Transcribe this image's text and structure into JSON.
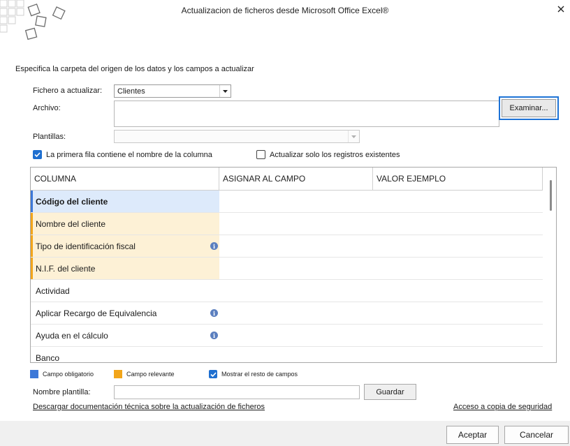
{
  "window": {
    "title": "Actualizacion de ficheros desde Microsoft Office Excel®",
    "close_icon": "close-icon"
  },
  "form": {
    "subtitle": "Especifica la carpeta del origen de los datos y los campos a actualizar",
    "fichero_label": "Fichero a actualizar:",
    "fichero_value": "Clientes",
    "archivo_label": "Archivo:",
    "archivo_value": "",
    "examinar_label": "Examinar...",
    "plantillas_label": "Plantillas:",
    "plantillas_value": "",
    "primera_fila_label": "La primera fila contiene el nombre de la columna",
    "primera_fila_checked": true,
    "actualizar_label": "Actualizar solo los registros existentes",
    "actualizar_checked": false
  },
  "grid": {
    "columns": [
      "COLUMNA",
      "ASIGNAR AL CAMPO",
      "VALOR EJEMPLO"
    ],
    "rows": [
      {
        "name": "Código del cliente",
        "state": "selected",
        "info": false
      },
      {
        "name": "Nombre del cliente",
        "state": "relevant",
        "info": false
      },
      {
        "name": "Tipo de identificación fiscal",
        "state": "relevant",
        "info": true
      },
      {
        "name": "N.I.F. del cliente",
        "state": "relevant",
        "info": false
      },
      {
        "name": "Actividad",
        "state": "normal",
        "info": false
      },
      {
        "name": "Aplicar Recargo de Equivalencia",
        "state": "normal",
        "info": true
      },
      {
        "name": "Ayuda en el cálculo",
        "state": "normal",
        "info": true
      },
      {
        "name": "Banco",
        "state": "normal",
        "info": false
      }
    ]
  },
  "legend": {
    "obligatorio_label": "Campo obligatorio",
    "obligatorio_color": "#3c78d8",
    "relevante_label": "Campo relevante",
    "relevante_color": "#f2a51a",
    "mostrar_label": "Mostrar el resto de campos",
    "mostrar_checked": true
  },
  "plantilla": {
    "nombre_label": "Nombre plantilla:",
    "nombre_value": "",
    "guardar_label": "Guardar"
  },
  "links": {
    "documentacion": "Descargar documentación técnica sobre la actualización de ficheros",
    "copia_seguridad": "Acceso a copia de seguridad"
  },
  "footer": {
    "aceptar_label": "Aceptar",
    "cancelar_label": "Cancelar"
  }
}
